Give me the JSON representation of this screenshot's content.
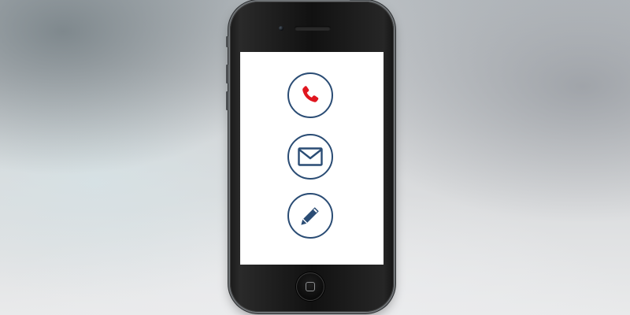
{
  "colors": {
    "icon_ring": "#2a4c74",
    "phone_icon": "#e0161f",
    "mail_icon": "#2a4c74",
    "pencil_icon": "#2a4c74",
    "screen": "#ffffff",
    "phone_body": "#111111"
  },
  "icons": [
    {
      "name": "phone-icon",
      "action": "call"
    },
    {
      "name": "envelope-icon",
      "action": "mail"
    },
    {
      "name": "pencil-icon",
      "action": "edit"
    }
  ]
}
